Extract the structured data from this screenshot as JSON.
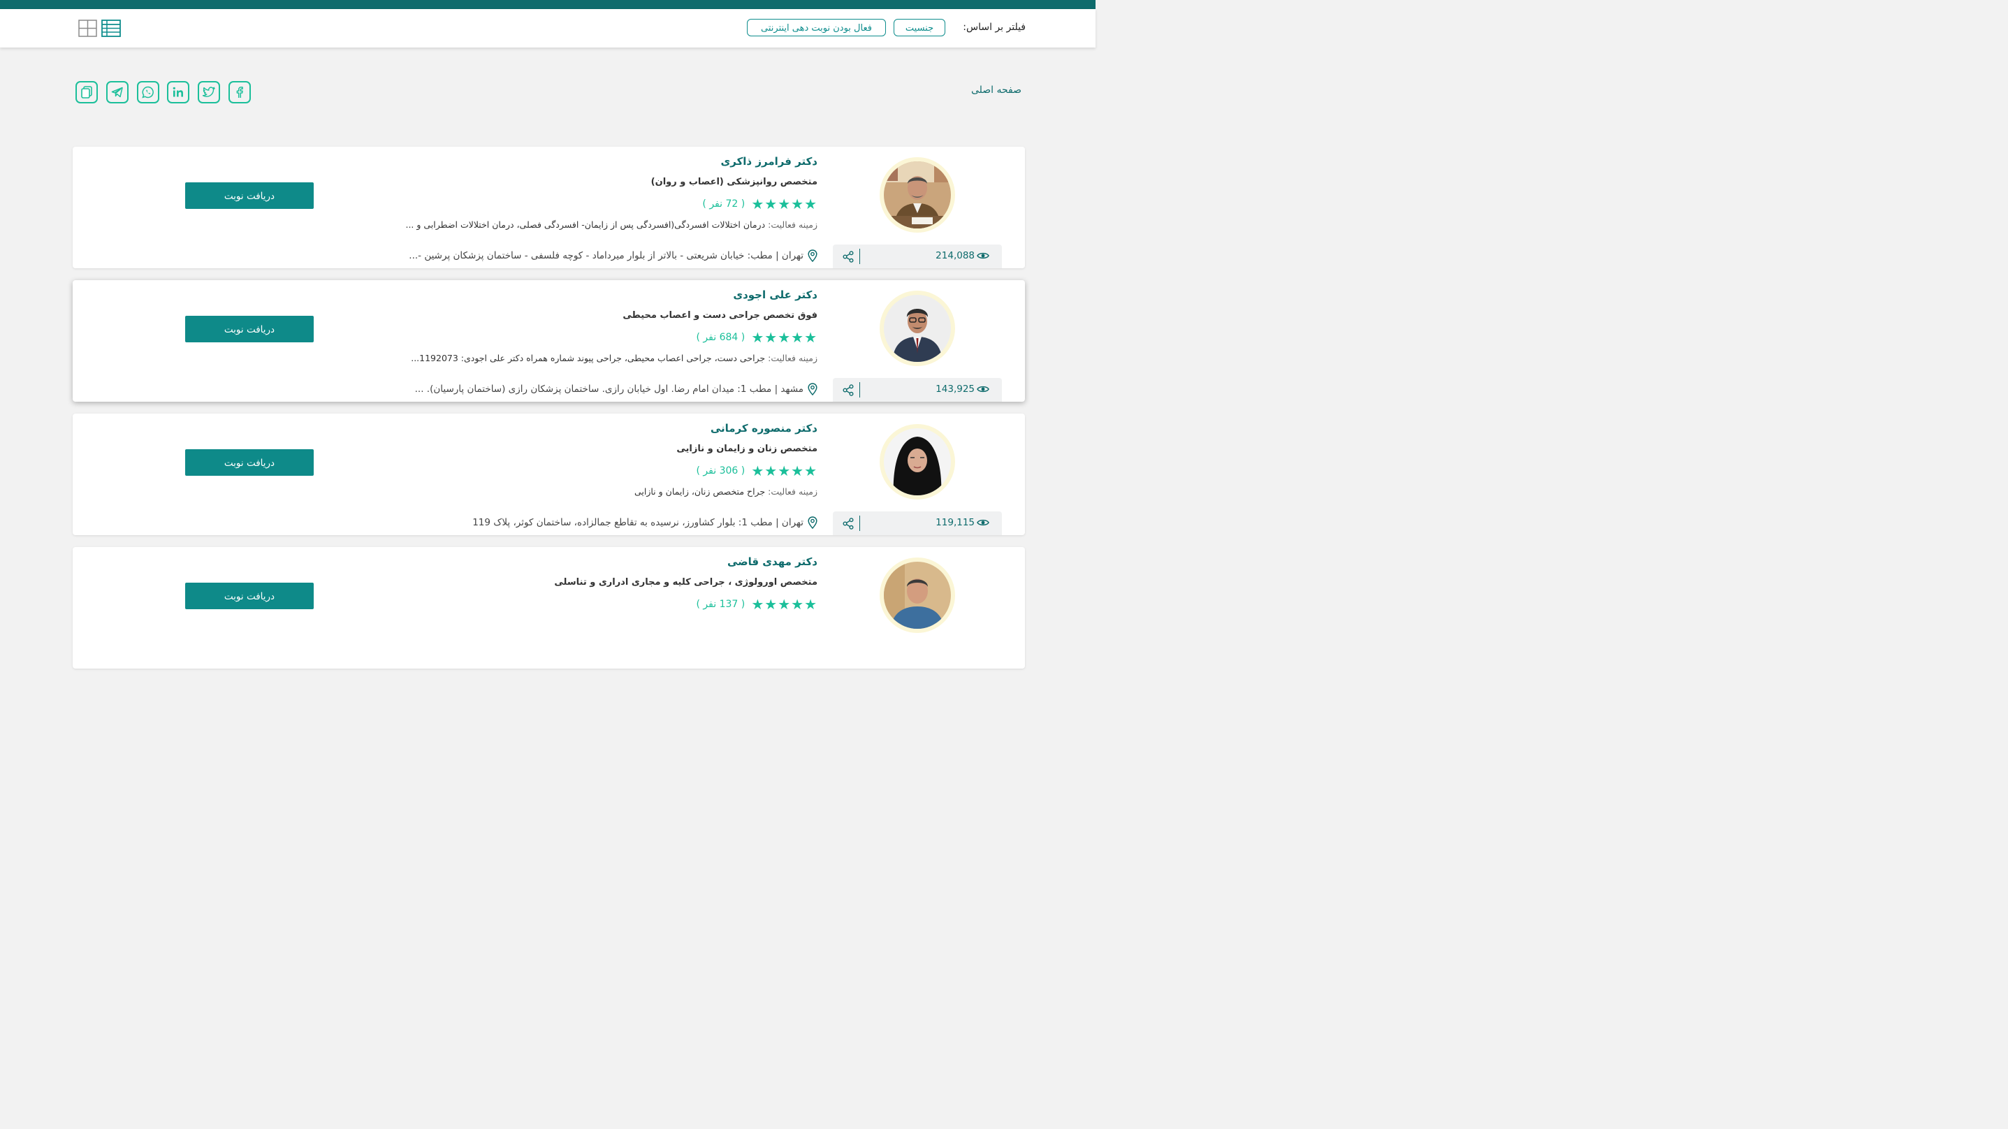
{
  "filter": {
    "label": "فیلتر بر اساس:",
    "gender": "جنسیت",
    "online": "فعال بودن نوبت دهی اینترنتی"
  },
  "breadcrumb": "صفحه اصلی",
  "share_icons": [
    "copy-icon",
    "telegram-icon",
    "whatsapp-icon",
    "linkedin-icon",
    "twitter-icon",
    "facebook-icon"
  ],
  "colors": {
    "primary": "#0e6b6c",
    "button": "#0e8a89",
    "accent": "#1bbf9a"
  },
  "activity_label": "زمینه فعالیت:",
  "doctors": [
    {
      "name": "دکتر فرامرز ذاکری",
      "specialty": "متخصص روانپزشکی (اعصاب و روان)",
      "stars": "★★★★★",
      "rating_count": "( 72 نفر )",
      "activity": "درمان اختلالات افسردگی(افسردگی پس از زایمان- افسردگی فصلی، درمان اختلالات اضطرابی و ...",
      "address": "تهران | مطب: خیابان شریعتی - بالاتر از بلوار میرداماد - کوچه فلسفی - ساختمان پزشکان پرشین -...",
      "views": "214,088",
      "button": "دریافت نوبت"
    },
    {
      "name": "دکتر علی اجودی",
      "specialty": "فوق تخصص جراحی دست و اعصاب محیطی",
      "stars": "★★★★★",
      "rating_count": "( 684 نفر )",
      "activity": "جراحی دست، جراحی اعصاب محیطی، جراحی پیوند شماره همراه دکتر علی اجودی: 1192073...",
      "address": "مشهد | مطب 1: میدان امام رضا. اول خیابان رازی. ساختمان پزشکان رازی (ساختمان پارسیان). ...",
      "views": "143,925",
      "button": "دریافت نوبت"
    },
    {
      "name": "دکتر منصوره کرمانی",
      "specialty": "متخصص زنان و زایمان و نازایی",
      "stars": "★★★★★",
      "rating_count": "( 306 نفر )",
      "activity": "جراح متخصص زنان، زایمان و نازایی",
      "address": "تهران | مطب 1: بلوار کشاورز، نرسیده به تقاطع جمالزاده، ساختمان کوثر، پلاک 119",
      "views": "119,115",
      "button": "دریافت نوبت"
    },
    {
      "name": "دکتر مهدی قاضی",
      "specialty": "متخصص اورولوژی ، جراحی کلیه و مجاری ادراری و تناسلی",
      "stars": "★★★★★",
      "rating_count": "( 137 نفر )",
      "activity": "",
      "address": "",
      "views": "",
      "button": "دریافت نوبت"
    }
  ]
}
